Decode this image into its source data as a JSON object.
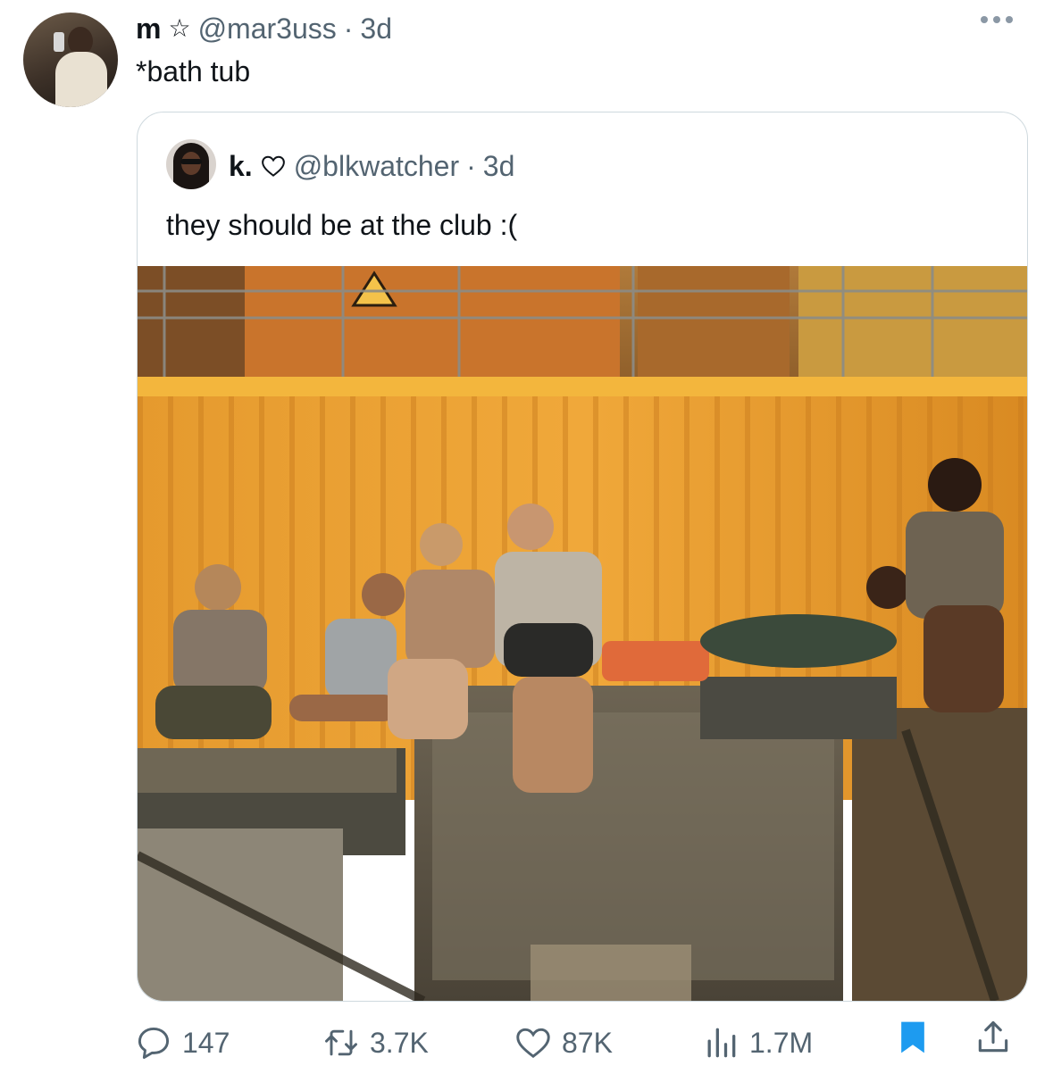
{
  "tweet": {
    "display_name": "m",
    "badge_icon": "star-outline-icon",
    "handle": "@mar3uss",
    "separator": "·",
    "time": "3d",
    "text": "*bath tub"
  },
  "quoted_tweet": {
    "display_name": "k.",
    "badge_icon": "heart-outline-icon",
    "handle": "@blkwatcher",
    "separator": "·",
    "time": "3d",
    "text": "they should be at the club :(",
    "photo_description_icon": "photo"
  },
  "actions": {
    "replies": "147",
    "reposts": "3.7K",
    "likes": "87K",
    "views": "1.7M"
  },
  "colors": {
    "accent_blue": "#1d9bf0",
    "secondary_text": "#536471",
    "container_orange": "#e8942a"
  }
}
